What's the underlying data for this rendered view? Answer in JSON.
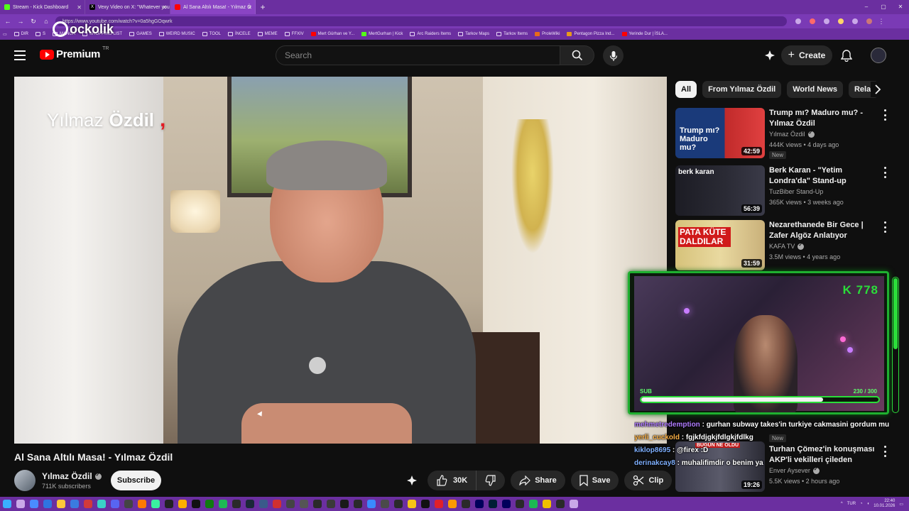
{
  "browser": {
    "tabs": [
      {
        "title": "Stream - Kick Dashboard",
        "fav_color": "#53fc18",
        "active": false
      },
      {
        "title": "Vexy Video on X: \"Whatever you",
        "fav_color": "#000000",
        "active": false
      },
      {
        "title": "Al Sana Altılı Masa! - Yılmaz Ö",
        "fav_color": "#ff0000",
        "active": true
      }
    ],
    "new_tab": "+",
    "window_controls": [
      "–",
      "▢",
      "✕"
    ],
    "url": "https://www.youtube.com/watch?v=0a5hgGOqwrk",
    "bookmarks": [
      "DIR",
      "S",
      "MANGA",
      "SHOPPING LIST",
      "GAMES",
      "WEIRD MUSIC",
      "TOOL",
      "İNCELE",
      "MEME",
      "FFXIV",
      "Mert Gürhan ve Y...",
      "MertGurhan | Kick",
      "Arc Raiders Items",
      "Tarkov Maps",
      "Tarkov Items",
      "ProleWiki",
      "Pentagon Pizza Ind...",
      "Yerinde Dur | İSLA..."
    ],
    "overlay_brand": "ockolik"
  },
  "header": {
    "brand": "Premium",
    "region": "TR",
    "search_placeholder": "Search",
    "create_label": "Create"
  },
  "video": {
    "watermark_first": "Yılmaz",
    "watermark_last": "Özdil",
    "watermark_mark": ",",
    "title": "Al Sana Altılı Masa! - Yılmaz Özdil",
    "channel": "Yılmaz Özdil",
    "subscribers": "711K subscribers",
    "subscribe_label": "Subscribe",
    "likes": "30K",
    "share_label": "Share",
    "save_label": "Save",
    "clip_label": "Clip"
  },
  "chips": [
    "All",
    "From Yılmaz Özdil",
    "World News",
    "Relat"
  ],
  "recommendations": [
    {
      "title": "Trump mı? Maduro mu? - Yılmaz Özdil",
      "channel": "Yılmaz Özdil",
      "verified": true,
      "meta": "444K views • 4 days ago",
      "badge": "New",
      "duration": "42:59",
      "thumb_text": "Trump mı? Maduro mu?"
    },
    {
      "title": "Berk Karan - \"Yetim Londra'da\" Stand-up Gösterisi | TuzBiber ...",
      "channel": "TuzBiber Stand-Up",
      "verified": false,
      "meta": "365K views • 3 weeks ago",
      "badge": "",
      "duration": "56:39",
      "thumb_text": "berk karan"
    },
    {
      "title": "Nezarethanede Bir Gece | Zafer Algöz Anlatıyor",
      "channel": "KAFA TV",
      "verified": true,
      "meta": "3.5M views • 4 years ago",
      "badge": "",
      "duration": "31:59",
      "thumb_text": "PATA KÜTE DALDILAR"
    },
    {
      "title": "Turhan Çömez'in konuşması AKP'li vekilleri çileden çıkardı: ...",
      "channel": "Enver Aysever",
      "verified": true,
      "meta": "5.5K views • 2 hours ago",
      "badge": "New",
      "duration": "19:26",
      "thumb_text": "BUGÜN NE OLDU"
    }
  ],
  "stream": {
    "badge": "K 778",
    "sub_label": "SUB",
    "sub_count": "230 / 300",
    "sub_progress": 0.7667
  },
  "chat": [
    {
      "user": "mehmetredemption",
      "message": "gurhan subway takes'in turkiye cakmasini gordum mu",
      "color": "#b07cff"
    },
    {
      "user": "yerli_cuckold",
      "message": "fgjkfdjgkjfdlgkjfdlkg",
      "color": "#ffb347"
    },
    {
      "user": "kiklop8695",
      "message": "@firex :D",
      "color": "#7fb0ff"
    },
    {
      "user": "derinakcay8",
      "message": "muhalifimdir o benim ya",
      "color": "#7fb0ff"
    }
  ],
  "tray": {
    "lang": "TUR",
    "time": "22:40",
    "date": "10.01.2026"
  },
  "colors": {
    "accent_red": "#ff0000",
    "chrome_purple": "#6b2fa0",
    "stream_green": "#2bdd3a"
  }
}
